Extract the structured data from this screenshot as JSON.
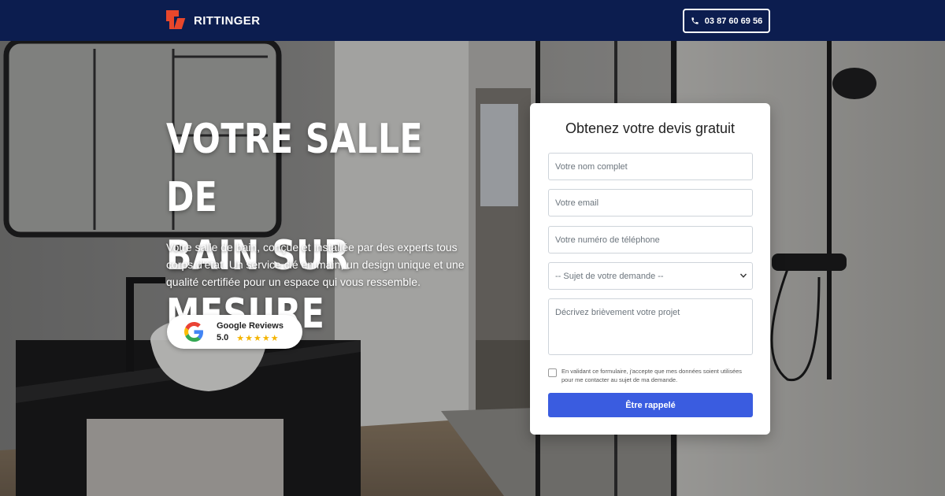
{
  "header": {
    "brand": "RITTINGER",
    "phone": "03 87 60 69 56"
  },
  "hero": {
    "title_line1": "VOTRE SALLE DE",
    "title_line2": "BAIN SUR MESURE",
    "subtitle": "Votre salle de bain, conçue et installée par des experts tous corps d'état. Un service clé en main, un design unique et une qualité certifiée pour un espace qui vous ressemble.",
    "reviews": {
      "label": "Google Reviews",
      "score": "5.0",
      "stars": "★★★★★",
      "rating": 5
    }
  },
  "form": {
    "title": "Obtenez votre devis gratuit",
    "name_placeholder": "Votre nom complet",
    "email_placeholder": "Votre email",
    "phone_placeholder": "Votre numéro de téléphone",
    "subject_selected": "-- Sujet de votre demande --",
    "project_placeholder": "Décrivez brièvement votre projet",
    "consent": "En validant ce formulaire, j'accepte que mes données soient utilisées pour me contacter au sujet de ma demande.",
    "submit": "Être rappelé"
  },
  "colors": {
    "header_bg": "#0c1d4f",
    "accent": "#e8472b",
    "submit_bg": "#3a5ce0",
    "stars": "#f4b400"
  },
  "icons": {
    "phone": "phone-icon",
    "google": "google-icon",
    "chevron": "chevron-down-icon"
  }
}
